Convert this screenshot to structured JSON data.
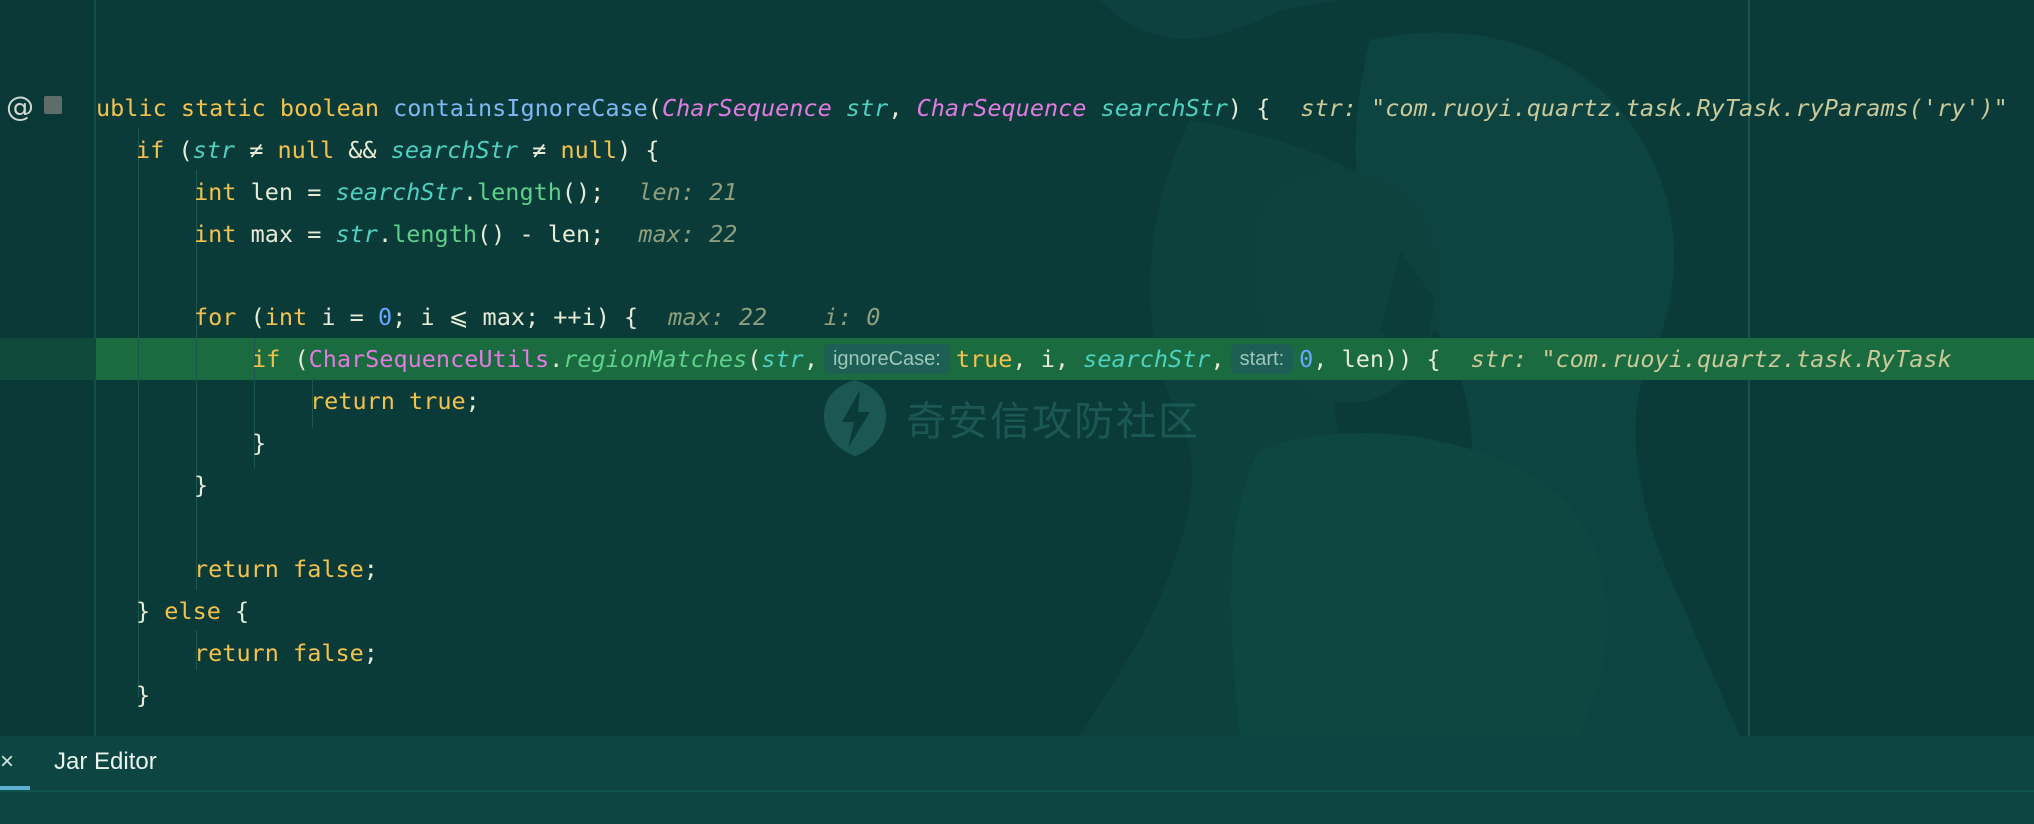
{
  "code": {
    "line1": {
      "t1": "ublic static boolean ",
      "fn": "containsIgnoreCase",
      "p1": "(",
      "type1": "CharSequence",
      "s1": " ",
      "param1": "str",
      "p2": ", ",
      "type2": "CharSequence",
      "s2": " ",
      "param2": "searchStr",
      "p3": ") {",
      "hint": "str: \"com.ruoyi.quartz.task.RyTask.ryParams('ry')\""
    },
    "line2": {
      "kw": "if",
      "p1": " (",
      "param1": "str",
      "p2": " ≠ ",
      "kw2": "null",
      "p3": " && ",
      "param2": "searchStr",
      "p4": " ≠ ",
      "kw3": "null",
      "p5": ") {"
    },
    "line3": {
      "kw": "int",
      "p1": " len = ",
      "param": "searchStr",
      "p2": ".",
      "fn": "length",
      "p3": "();",
      "hint": "len: 21"
    },
    "line4": {
      "kw": "int",
      "p1": " max = ",
      "param": "str",
      "p2": ".",
      "fn": "length",
      "p3": "() - len;",
      "hint": "max: 22"
    },
    "line5": {
      "kw": "for",
      "p1": " (",
      "kw2": "int",
      "p2": " i = ",
      "num": "0",
      "p3": "; i ⩽ max; ++i) {",
      "hint": "max: 22    i: 0"
    },
    "line6": {
      "kw": "if",
      "p1": " (",
      "cls": "CharSequenceUtils",
      "p2": ".",
      "fn": "regionMatches",
      "p3": "(",
      "param1": "str",
      "p4": ",",
      "inlay1": "ignoreCase:",
      "kw2": "true",
      "p5": ", i, ",
      "param2": "searchStr",
      "p6": ",",
      "inlay2": "start:",
      "num": "0",
      "p7": ", len)) {",
      "hint": "str: \"com.ruoyi.quartz.task.RyTask"
    },
    "line7": {
      "kw": "return",
      "s": " ",
      "kw2": "true",
      "p": ";"
    },
    "line8": {
      "p": "}"
    },
    "line9": {
      "p": "}"
    },
    "line11": {
      "kw": "return",
      "s": " ",
      "kw2": "false",
      "p": ";"
    },
    "line12": {
      "p1": "} ",
      "kw": "else",
      "p2": " {"
    },
    "line13": {
      "kw": "return",
      "s": " ",
      "kw2": "false",
      "p": ";"
    },
    "line14": {
      "p": "}"
    }
  },
  "gutter": {
    "at_icon": "@",
    "bookmark_icon": "bookmark-icon"
  },
  "watermark": {
    "text": "奇安信攻防社区",
    "icon": "lightning-shield-icon"
  },
  "bottom": {
    "close_glyph": "×",
    "tab_label": "Jar Editor"
  },
  "colors": {
    "keyword": "#f2c14e",
    "method": "#7fb8f5",
    "type": "#e07be0",
    "param": "#4fd0c0",
    "highlight": "#1a6b3f",
    "background": "#0b3b39"
  }
}
